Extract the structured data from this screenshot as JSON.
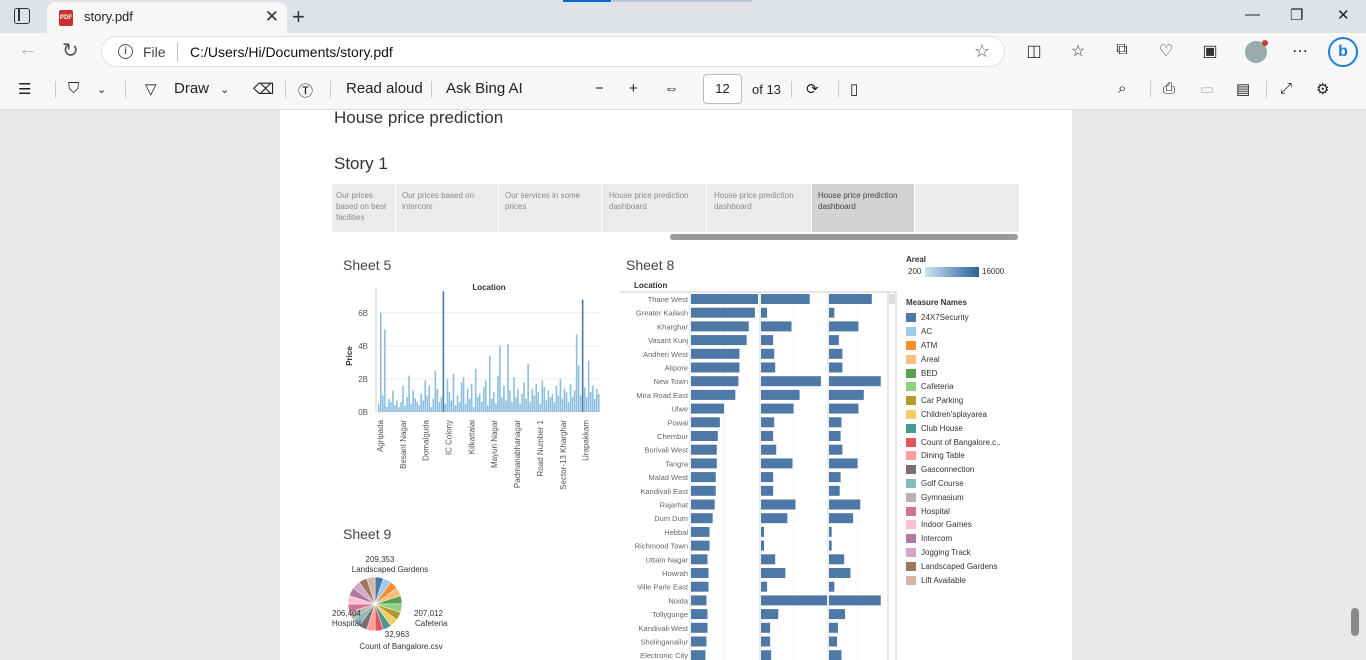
{
  "browser": {
    "tab_title": "story.pdf",
    "tab_icon_label": "PDF",
    "url_scheme_label": "File",
    "url": "C:/Users/Hi/Documents/story.pdf"
  },
  "pdf_toolbar": {
    "draw_label": "Draw",
    "read_aloud_label": "Read aloud",
    "ask_bing_label": "Ask Bing AI",
    "page_current": "12",
    "page_total": "of 13"
  },
  "document": {
    "title": "House price prediction",
    "story_title": "Story 1",
    "story_points": [
      "Our prices based on best facilities",
      "Our prices based on intercom",
      "Our services in some prices",
      "House price prediction dashboard",
      "House price prediction dashboard",
      "House price prediction dashboard"
    ],
    "sheet5_title": "Sheet 5",
    "sheet8_title": "Sheet 8",
    "sheet9_title": "Sheet 9",
    "legend": {
      "areal_title": "Areal",
      "areal_min": "200",
      "areal_max": "16000",
      "measure_names_title": "Measure Names",
      "items": [
        {
          "label": "24X7Security",
          "color": "#4e79a7"
        },
        {
          "label": "AC",
          "color": "#a0cbe8"
        },
        {
          "label": "ATM",
          "color": "#f28e2b"
        },
        {
          "label": "Areal",
          "color": "#ffbe7d"
        },
        {
          "label": "BED",
          "color": "#59a14f"
        },
        {
          "label": "Cafeteria",
          "color": "#8cd17d"
        },
        {
          "label": "Car Parking",
          "color": "#b6992d"
        },
        {
          "label": "Children'splayarea",
          "color": "#f1ce63"
        },
        {
          "label": "Club House",
          "color": "#499894"
        },
        {
          "label": "Count of Bangalore.c..",
          "color": "#e15759"
        },
        {
          "label": "Dining Table",
          "color": "#ff9d9a"
        },
        {
          "label": "Gasconnection",
          "color": "#79706e"
        },
        {
          "label": "Golf Course",
          "color": "#86bcb6"
        },
        {
          "label": "Gymnasium",
          "color": "#bab0ac"
        },
        {
          "label": "Hospital",
          "color": "#d37295"
        },
        {
          "label": "Indoor Games",
          "color": "#fabfd2"
        },
        {
          "label": "Intercom",
          "color": "#b07aa1"
        },
        {
          "label": "Jogging Track",
          "color": "#d4a6c8"
        },
        {
          "label": "Landscaped Gardens",
          "color": "#9d7660"
        },
        {
          "label": "Lift Available",
          "color": "#d7b5a6"
        }
      ]
    }
  },
  "chart_data": [
    {
      "type": "bar",
      "name": "Sheet 5",
      "title": "Location",
      "ylabel": "Price",
      "yticks": [
        "0B",
        "2B",
        "4B",
        "6B"
      ],
      "ylim": [
        0,
        7.5
      ],
      "units": "B",
      "categories": [
        "Agripada",
        "Besant Nagar",
        "Domalguda",
        "IC Colony",
        "Kilkattalai",
        "Mayuri Nagar",
        "Padmanabhanagar",
        "Road Number 1",
        "Sector-13 Kharghar",
        "Urapakkam"
      ],
      "values": [
        0.5,
        6,
        1,
        5,
        0.3,
        0.8,
        0.6,
        1.3,
        0.4,
        0.7,
        0.3,
        0.6,
        1.6,
        0.4,
        0.9,
        2.2,
        0.5,
        1.3,
        0.8,
        0.6,
        0.4,
        1.1,
        0.7,
        1.9,
        1.0,
        1.6,
        0.3,
        0.8,
        2.5,
        1.4,
        0.6,
        0.9,
        7.3,
        0.5,
        2.0,
        1.2,
        0.7,
        2.3,
        0.4,
        1.0,
        0.6,
        1.8,
        2.1,
        0.5,
        1.4,
        0.8,
        1.7,
        0.3,
        2.6,
        0.9,
        1.1,
        0.6,
        1.5,
        1.9,
        0.4,
        3.4,
        0.8,
        1.2,
        0.5,
        2.2,
        4.0,
        0.9,
        1.6,
        0.7,
        4.1,
        1.3,
        0.6,
        2.1,
        0.9,
        1.4,
        0.5,
        1.1,
        1.8,
        0.8,
        2.9,
        0.6,
        1.4,
        1.0,
        1.7,
        1.2,
        0.5,
        1.9,
        1.5,
        0.7,
        1.3,
        0.9,
        1.1,
        0.6,
        1.6,
        1.0,
        2.0,
        0.8,
        1.4,
        1.2,
        0.6,
        1.7,
        0.9,
        1.3,
        4.7,
        2.8,
        1.0,
        6.8,
        1.5,
        0.9,
        3.1,
        1.2,
        1.6,
        0.8,
        1.4,
        1.1
      ]
    },
    {
      "type": "bar",
      "name": "Sheet 8",
      "title": "Location",
      "categories": [
        "Thane West",
        "Greater Kailash",
        "Kharghar",
        "Vasant Kunj",
        "Andheri West",
        "Alipore",
        "New Town",
        "Mira Road East",
        "Ulwe",
        "Powai",
        "Chembur",
        "Borivali West",
        "Tangra",
        "Malad West",
        "Kandivali East",
        "Rajarhat",
        "Dum Dum",
        "Hebbal",
        "Richmond Town",
        "Uttam Nagar",
        "Howrah",
        "Ville Parle East",
        "Noida",
        "Tollygunge",
        "Kandivali West",
        "Sholinganallur",
        "Electronic City"
      ],
      "series": [
        {
          "values": [
            65,
            62,
            56,
            54,
            47,
            47,
            46,
            43,
            32,
            28,
            26,
            25,
            25,
            24,
            24,
            23,
            21,
            18,
            18,
            16,
            17,
            17,
            15,
            16,
            16,
            15,
            14
          ]
        },
        {
          "values": [
            48,
            6,
            30,
            12,
            13,
            14,
            59,
            38,
            32,
            13,
            12,
            15,
            31,
            12,
            12,
            34,
            26,
            3,
            3,
            14,
            24,
            6,
            65,
            17,
            9,
            9,
            10
          ]
        },
        {
          "values": [
            48,
            6,
            33,
            11,
            15,
            15,
            58,
            39,
            33,
            14,
            13,
            15,
            32,
            13,
            12,
            35,
            27,
            3,
            3,
            17,
            24,
            6,
            58,
            18,
            10,
            9,
            14
          ]
        }
      ]
    },
    {
      "type": "pie",
      "name": "Sheet 9",
      "labels": [
        "Landscaped Gardens",
        "Cafeteria",
        "Count of Bangalore.csv",
        "Hospital"
      ],
      "annotated_values": [
        209353,
        207012,
        32963,
        206404
      ],
      "annotations": [
        "209,353",
        "207,012",
        "32,963",
        "206,404"
      ]
    }
  ]
}
